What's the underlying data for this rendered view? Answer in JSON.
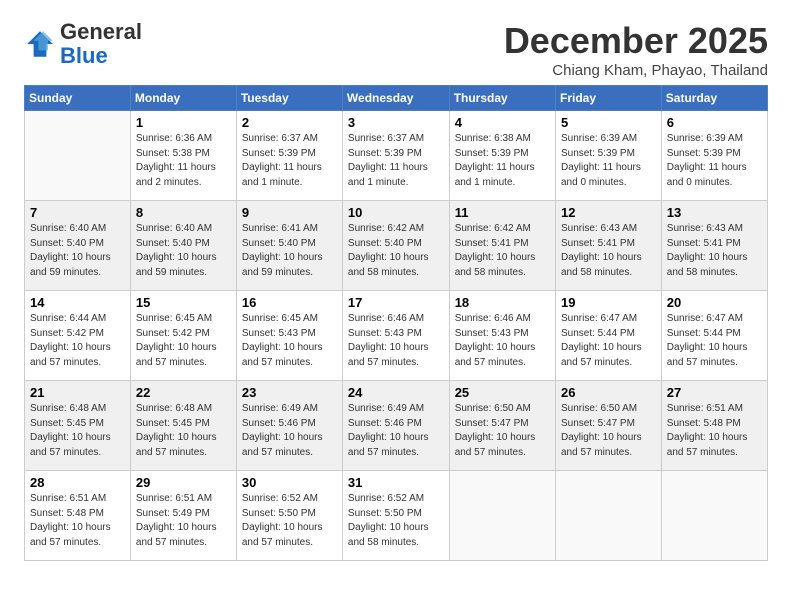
{
  "header": {
    "logo_general": "General",
    "logo_blue": "Blue",
    "month_title": "December 2025",
    "subtitle": "Chiang Kham, Phayao, Thailand"
  },
  "weekdays": [
    "Sunday",
    "Monday",
    "Tuesday",
    "Wednesday",
    "Thursday",
    "Friday",
    "Saturday"
  ],
  "weeks": [
    [
      {
        "day": "",
        "info": ""
      },
      {
        "day": "1",
        "info": "Sunrise: 6:36 AM\nSunset: 5:38 PM\nDaylight: 11 hours\nand 2 minutes."
      },
      {
        "day": "2",
        "info": "Sunrise: 6:37 AM\nSunset: 5:39 PM\nDaylight: 11 hours\nand 1 minute."
      },
      {
        "day": "3",
        "info": "Sunrise: 6:37 AM\nSunset: 5:39 PM\nDaylight: 11 hours\nand 1 minute."
      },
      {
        "day": "4",
        "info": "Sunrise: 6:38 AM\nSunset: 5:39 PM\nDaylight: 11 hours\nand 1 minute."
      },
      {
        "day": "5",
        "info": "Sunrise: 6:39 AM\nSunset: 5:39 PM\nDaylight: 11 hours\nand 0 minutes."
      },
      {
        "day": "6",
        "info": "Sunrise: 6:39 AM\nSunset: 5:39 PM\nDaylight: 11 hours\nand 0 minutes."
      }
    ],
    [
      {
        "day": "7",
        "info": "Sunrise: 6:40 AM\nSunset: 5:40 PM\nDaylight: 10 hours\nand 59 minutes."
      },
      {
        "day": "8",
        "info": "Sunrise: 6:40 AM\nSunset: 5:40 PM\nDaylight: 10 hours\nand 59 minutes."
      },
      {
        "day": "9",
        "info": "Sunrise: 6:41 AM\nSunset: 5:40 PM\nDaylight: 10 hours\nand 59 minutes."
      },
      {
        "day": "10",
        "info": "Sunrise: 6:42 AM\nSunset: 5:40 PM\nDaylight: 10 hours\nand 58 minutes."
      },
      {
        "day": "11",
        "info": "Sunrise: 6:42 AM\nSunset: 5:41 PM\nDaylight: 10 hours\nand 58 minutes."
      },
      {
        "day": "12",
        "info": "Sunrise: 6:43 AM\nSunset: 5:41 PM\nDaylight: 10 hours\nand 58 minutes."
      },
      {
        "day": "13",
        "info": "Sunrise: 6:43 AM\nSunset: 5:41 PM\nDaylight: 10 hours\nand 58 minutes."
      }
    ],
    [
      {
        "day": "14",
        "info": "Sunrise: 6:44 AM\nSunset: 5:42 PM\nDaylight: 10 hours\nand 57 minutes."
      },
      {
        "day": "15",
        "info": "Sunrise: 6:45 AM\nSunset: 5:42 PM\nDaylight: 10 hours\nand 57 minutes."
      },
      {
        "day": "16",
        "info": "Sunrise: 6:45 AM\nSunset: 5:43 PM\nDaylight: 10 hours\nand 57 minutes."
      },
      {
        "day": "17",
        "info": "Sunrise: 6:46 AM\nSunset: 5:43 PM\nDaylight: 10 hours\nand 57 minutes."
      },
      {
        "day": "18",
        "info": "Sunrise: 6:46 AM\nSunset: 5:43 PM\nDaylight: 10 hours\nand 57 minutes."
      },
      {
        "day": "19",
        "info": "Sunrise: 6:47 AM\nSunset: 5:44 PM\nDaylight: 10 hours\nand 57 minutes."
      },
      {
        "day": "20",
        "info": "Sunrise: 6:47 AM\nSunset: 5:44 PM\nDaylight: 10 hours\nand 57 minutes."
      }
    ],
    [
      {
        "day": "21",
        "info": "Sunrise: 6:48 AM\nSunset: 5:45 PM\nDaylight: 10 hours\nand 57 minutes."
      },
      {
        "day": "22",
        "info": "Sunrise: 6:48 AM\nSunset: 5:45 PM\nDaylight: 10 hours\nand 57 minutes."
      },
      {
        "day": "23",
        "info": "Sunrise: 6:49 AM\nSunset: 5:46 PM\nDaylight: 10 hours\nand 57 minutes."
      },
      {
        "day": "24",
        "info": "Sunrise: 6:49 AM\nSunset: 5:46 PM\nDaylight: 10 hours\nand 57 minutes."
      },
      {
        "day": "25",
        "info": "Sunrise: 6:50 AM\nSunset: 5:47 PM\nDaylight: 10 hours\nand 57 minutes."
      },
      {
        "day": "26",
        "info": "Sunrise: 6:50 AM\nSunset: 5:47 PM\nDaylight: 10 hours\nand 57 minutes."
      },
      {
        "day": "27",
        "info": "Sunrise: 6:51 AM\nSunset: 5:48 PM\nDaylight: 10 hours\nand 57 minutes."
      }
    ],
    [
      {
        "day": "28",
        "info": "Sunrise: 6:51 AM\nSunset: 5:48 PM\nDaylight: 10 hours\nand 57 minutes."
      },
      {
        "day": "29",
        "info": "Sunrise: 6:51 AM\nSunset: 5:49 PM\nDaylight: 10 hours\nand 57 minutes."
      },
      {
        "day": "30",
        "info": "Sunrise: 6:52 AM\nSunset: 5:50 PM\nDaylight: 10 hours\nand 57 minutes."
      },
      {
        "day": "31",
        "info": "Sunrise: 6:52 AM\nSunset: 5:50 PM\nDaylight: 10 hours\nand 58 minutes."
      },
      {
        "day": "",
        "info": ""
      },
      {
        "day": "",
        "info": ""
      },
      {
        "day": "",
        "info": ""
      }
    ]
  ]
}
